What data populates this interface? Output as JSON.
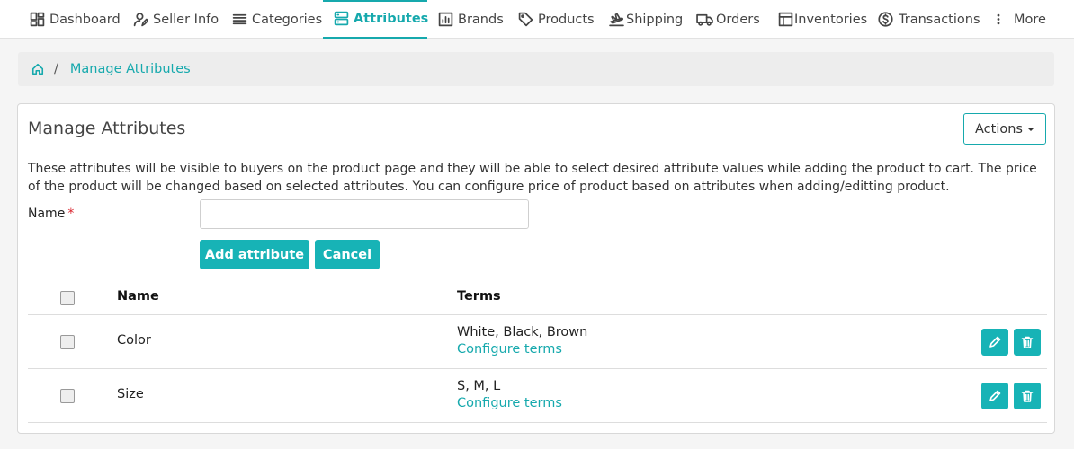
{
  "nav": {
    "items": [
      {
        "label": "Dashboard",
        "icon": "dashboard-icon"
      },
      {
        "label": "Seller Info",
        "icon": "user-edit-icon"
      },
      {
        "label": "Categories",
        "icon": "list-icon"
      },
      {
        "label": "Attributes",
        "icon": "server-icon",
        "active": true
      },
      {
        "label": "Brands",
        "icon": "bar-chart-icon"
      },
      {
        "label": "Products",
        "icon": "tag-icon"
      },
      {
        "label": "Shipping",
        "icon": "plane-icon"
      },
      {
        "label": "Orders",
        "icon": "truck-icon"
      },
      {
        "label": "Inventories",
        "icon": "inventory-icon"
      },
      {
        "label": "Transactions",
        "icon": "dollar-circle-icon"
      },
      {
        "label": "More",
        "icon": "more-vertical-icon"
      }
    ]
  },
  "breadcrumb": {
    "home_icon": "home-icon",
    "separator": "/",
    "current": "Manage Attributes"
  },
  "card": {
    "title": "Manage Attributes",
    "actions_label": "Actions",
    "description": "These attributes will be visible to buyers on the product page and they will be able to select desired attribute values while adding the product to cart. The price of the product will be changed based on selected attributes. You can configure price of product based on attributes when adding/editting product."
  },
  "form": {
    "name_label": "Name",
    "required_mark": "*",
    "name_value": "",
    "add_label": "Add attribute",
    "cancel_label": "Cancel"
  },
  "table": {
    "headers": {
      "name": "Name",
      "terms": "Terms"
    },
    "rows": [
      {
        "name": "Color",
        "terms": "White, Black, Brown",
        "link": "Configure terms"
      },
      {
        "name": "Size",
        "terms": "S, M, L",
        "link": "Configure terms"
      }
    ]
  },
  "colors": {
    "accent": "#17b3b6",
    "required": "#d9232d"
  }
}
